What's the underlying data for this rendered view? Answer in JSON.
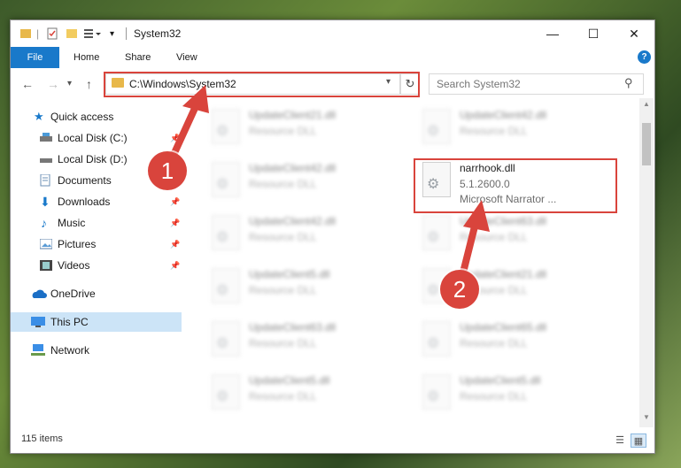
{
  "window": {
    "title": "System32"
  },
  "ribbon": {
    "file_tab": "File",
    "tabs": [
      "Home",
      "Share",
      "View"
    ],
    "help": "?"
  },
  "navigation": {
    "back_icon": "arrow-left-icon",
    "forward_icon": "arrow-right-icon",
    "up_icon": "arrow-up-icon",
    "address": "C:\\Windows\\System32",
    "search_placeholder": "Search System32"
  },
  "sidebar": {
    "items": [
      {
        "label": "Quick access",
        "icon": "star-icon",
        "pinned": false
      },
      {
        "label": "Local Disk (C:)",
        "icon": "drive-icon",
        "pinned": true
      },
      {
        "label": "Local Disk (D:)",
        "icon": "drive-icon",
        "pinned": false
      },
      {
        "label": "Documents",
        "icon": "documents-icon",
        "pinned": true
      },
      {
        "label": "Downloads",
        "icon": "downloads-icon",
        "pinned": true
      },
      {
        "label": "Music",
        "icon": "music-icon",
        "pinned": true
      },
      {
        "label": "Pictures",
        "icon": "pictures-icon",
        "pinned": true
      },
      {
        "label": "Videos",
        "icon": "videos-icon",
        "pinned": true
      },
      {
        "label": "OneDrive",
        "icon": "cloud-icon",
        "pinned": false
      },
      {
        "label": "This PC",
        "icon": "computer-icon",
        "pinned": false,
        "selected": true
      },
      {
        "label": "Network",
        "icon": "network-icon",
        "pinned": false
      }
    ]
  },
  "files": {
    "left_column": [
      {
        "name": "UpdateClient21.dll",
        "type": "Resource DLL"
      },
      {
        "name": "UpdateClient42.dll",
        "type": "Resource DLL"
      },
      {
        "name": "UpdateClient42.dll",
        "type": "Resource DLL"
      },
      {
        "name": "UpdateClient5.dll",
        "type": "Resource DLL"
      },
      {
        "name": "UpdateClient63.dll",
        "type": "Resource DLL"
      },
      {
        "name": "UpdateClient5.dll",
        "type": "Resource DLL"
      }
    ],
    "right_column": [
      {
        "name": "UpdateClient42.dll",
        "type": "Resource DLL"
      },
      {
        "name": "narrhook.dll",
        "version": "5.1.2600.0",
        "type": "Microsoft Narrator ...",
        "highlighted": true
      },
      {
        "name": "UpdateClient63.dll",
        "type": "Resource DLL"
      },
      {
        "name": "UpdateClient21.dll",
        "type": "Resource DLL"
      },
      {
        "name": "UpdateClient65.dll",
        "type": "Resource DLL"
      },
      {
        "name": "UpdateClient5.dll",
        "type": "Resource DLL"
      }
    ]
  },
  "status": {
    "item_count": "115 items"
  },
  "annotations": {
    "step1": "1",
    "step2": "2",
    "color": "#d9443c"
  }
}
